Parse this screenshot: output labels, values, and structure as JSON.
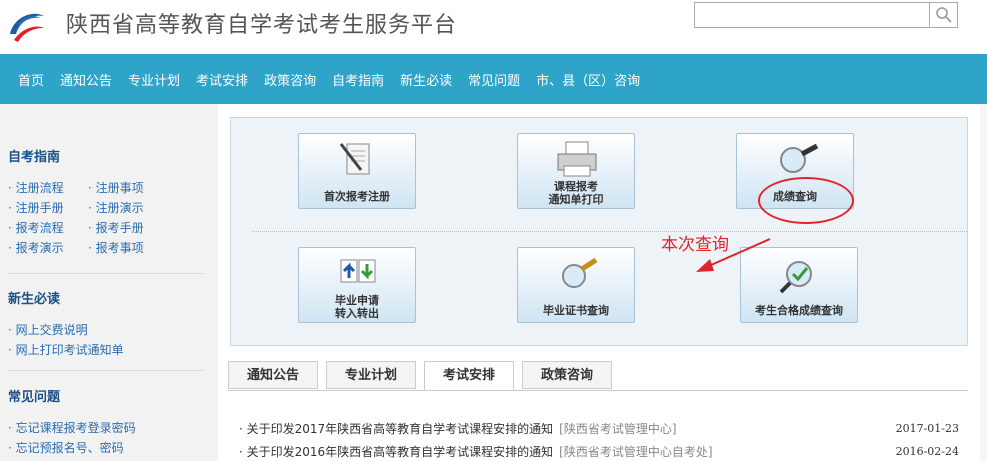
{
  "header": {
    "title": "陕西省高等教育自学考试考生服务平台",
    "search_placeholder": ""
  },
  "nav": {
    "items": [
      "首页",
      "通知公告",
      "专业计划",
      "考试安排",
      "政策咨询",
      "自考指南",
      "新生必读",
      "常见问题",
      "市、县（区）咨询"
    ]
  },
  "sidebar": {
    "guide": {
      "heading": "自考指南",
      "links": [
        "· 注册流程",
        "· 注册事项",
        "· 注册手册",
        "· 注册演示",
        "· 报考流程",
        "· 报考手册",
        "· 报考演示",
        "· 报考事项"
      ]
    },
    "newstudent": {
      "heading": "新生必读",
      "links": [
        "· 网上交费说明",
        "· 网上打印考试通知单"
      ]
    },
    "faq": {
      "heading": "常见问题",
      "links": [
        "· 忘记课程报考登录密码",
        "· 忘记预报名号、密码"
      ]
    }
  },
  "tiles": {
    "first_register": "首次报考注册",
    "course_print_1": "课程报考",
    "course_print_2": "通知单打印",
    "score_query": "成绩查询",
    "grad_apply_1": "毕业申请",
    "grad_apply_2": "转入转出",
    "cert_query": "毕业证书查询",
    "pass_query": "考生合格成绩查询"
  },
  "annotation": {
    "text": "本次查询",
    "color": "#e0242a"
  },
  "tabs": [
    "通知公告",
    "专业计划",
    "考试安排",
    "政策咨询"
  ],
  "news": [
    {
      "title": "· 关于印发2017年陕西省高等教育自学考试课程安排的通知",
      "source": "[陕西省考试管理中心]",
      "date": "2017-01-23"
    },
    {
      "title": "· 关于印发2016年陕西省高等教育自学考试课程安排的通知",
      "source": "[陕西省考试管理中心自考处]",
      "date": "2016-02-24"
    }
  ],
  "colors": {
    "nav_bg": "#2fa4c9",
    "sidebar_heading": "#1d4f86",
    "link": "#2a6db0"
  }
}
